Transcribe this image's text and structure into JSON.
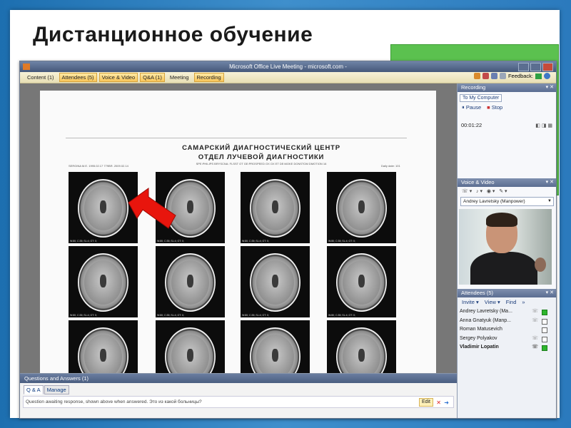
{
  "slide": {
    "title": "Дистанционное обучение"
  },
  "window": {
    "title": "Microsoft Office Live Meeting - microsoft.com -"
  },
  "menubar": {
    "tabs": [
      {
        "label": "Content (1)"
      },
      {
        "label": "Attendees (5)"
      },
      {
        "label": "Voice & Video"
      },
      {
        "label": "Q&A (1)"
      },
      {
        "label": "Meeting"
      },
      {
        "label": "Recording"
      }
    ],
    "feedback_label": "Feedback:"
  },
  "document": {
    "header_line1": "САМАРСКИЙ ДИАГНОСТИЧЕСКИЙ ЦЕНТР",
    "header_line2": "ОТДЕЛ ЛУЧЕВОЙ ДИАГНОСТИКИ",
    "header_line3": "SPE:PHILIPS BRYSCNA: FLSST OT GE:PROSPEED OX OX ET DE:MOKE DONSTOM DMOTION 16",
    "left_meta": "SERGINA M.E. 1995.02.17  779BR. 2009.02.14",
    "right_meta": "Daily date: 101",
    "scan_caption": "W:80; C:35; SL:4; GT: 0;"
  },
  "qa": {
    "header": "Questions and Answers (1)",
    "tabs": [
      "Q & A",
      "Manage"
    ],
    "message": "Question awaiting response, shown above when answered. Это из какой больницы?",
    "edit_label": "Edit"
  },
  "recording": {
    "header": "Recording",
    "tab": "To My Computer",
    "pause_label": "Pause",
    "stop_label": "Stop",
    "time": "00:01:22"
  },
  "voice_video": {
    "header": "Voice & Video",
    "selected_person": "Andrey Lavretsky (Manpower)"
  },
  "attendees": {
    "header": "Attendees (5)",
    "invite_label": "Invite",
    "view_label": "View",
    "find_label": "Find",
    "list": [
      {
        "name": "Andrey Lavretsky (Ma..."
      },
      {
        "name": "Anna Gnatyuk (Manp..."
      },
      {
        "name": "Roman Matusevich"
      },
      {
        "name": "Sergey Polyakov"
      },
      {
        "name": "Vladimir Lopatin"
      }
    ]
  }
}
